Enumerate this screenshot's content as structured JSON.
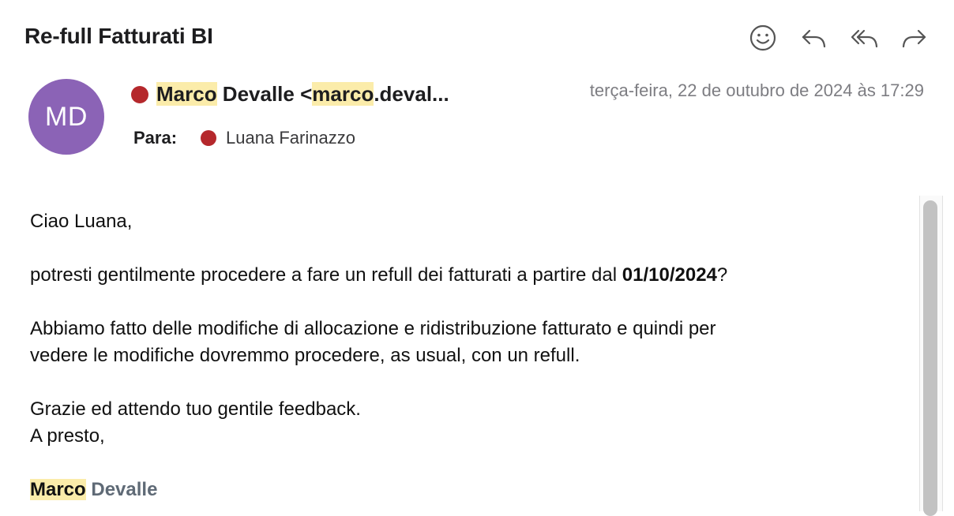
{
  "email": {
    "subject": "Re-full Fatturati BI",
    "sender": {
      "initials": "MD",
      "name_highlight": "Marco",
      "name_rest": " Devalle <",
      "email_highlight": "marco",
      "email_rest": ".deval..."
    },
    "date": "terça-feira, 22 de outubro de 2024 às 17:29",
    "to_label": "Para:",
    "to_name": "Luana Farinazzo"
  },
  "toolbar": {
    "icons": [
      "smiley-icon",
      "reply-icon",
      "reply-all-icon",
      "forward-icon"
    ]
  },
  "body": {
    "greeting": "Ciao Luana,",
    "p1_before": "potresti gentilmente procedere a fare un refull dei fatturati a partire dal ",
    "p1_bold": "01/10/2024",
    "p1_after": "?",
    "p2_line1": "Abbiamo fatto delle modifiche di allocazione e ridistribuzione fatturato e quindi per",
    "p2_line2": "vedere le modifiche dovremmo procedere, as usual, con un refull.",
    "closing1": "Grazie ed attendo tuo gentile feedback.",
    "closing2": "A presto,",
    "signature_first": "Marco",
    "signature_last": "Devalle"
  },
  "colors": {
    "avatar": "#8b63b6",
    "status_dot": "#b5282c",
    "highlight": "#fbecaa",
    "date_text": "#7d7d82"
  }
}
